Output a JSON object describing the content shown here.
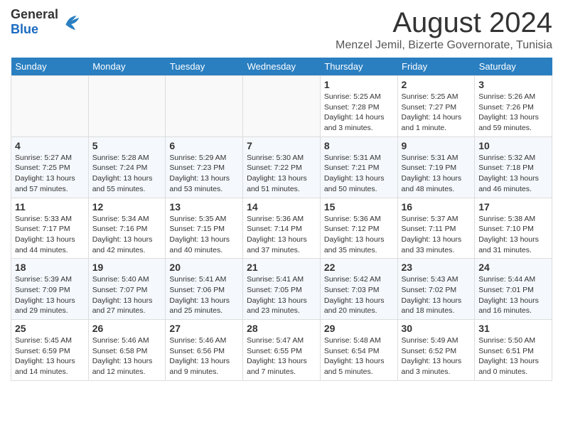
{
  "header": {
    "logo_general": "General",
    "logo_blue": "Blue",
    "month_title": "August 2024",
    "location": "Menzel Jemil, Bizerte Governorate, Tunisia"
  },
  "weekdays": [
    "Sunday",
    "Monday",
    "Tuesday",
    "Wednesday",
    "Thursday",
    "Friday",
    "Saturday"
  ],
  "weeks": [
    [
      {
        "day": "",
        "info": ""
      },
      {
        "day": "",
        "info": ""
      },
      {
        "day": "",
        "info": ""
      },
      {
        "day": "",
        "info": ""
      },
      {
        "day": "1",
        "info": "Sunrise: 5:25 AM\nSunset: 7:28 PM\nDaylight: 14 hours\nand 3 minutes."
      },
      {
        "day": "2",
        "info": "Sunrise: 5:25 AM\nSunset: 7:27 PM\nDaylight: 14 hours\nand 1 minute."
      },
      {
        "day": "3",
        "info": "Sunrise: 5:26 AM\nSunset: 7:26 PM\nDaylight: 13 hours\nand 59 minutes."
      }
    ],
    [
      {
        "day": "4",
        "info": "Sunrise: 5:27 AM\nSunset: 7:25 PM\nDaylight: 13 hours\nand 57 minutes."
      },
      {
        "day": "5",
        "info": "Sunrise: 5:28 AM\nSunset: 7:24 PM\nDaylight: 13 hours\nand 55 minutes."
      },
      {
        "day": "6",
        "info": "Sunrise: 5:29 AM\nSunset: 7:23 PM\nDaylight: 13 hours\nand 53 minutes."
      },
      {
        "day": "7",
        "info": "Sunrise: 5:30 AM\nSunset: 7:22 PM\nDaylight: 13 hours\nand 51 minutes."
      },
      {
        "day": "8",
        "info": "Sunrise: 5:31 AM\nSunset: 7:21 PM\nDaylight: 13 hours\nand 50 minutes."
      },
      {
        "day": "9",
        "info": "Sunrise: 5:31 AM\nSunset: 7:19 PM\nDaylight: 13 hours\nand 48 minutes."
      },
      {
        "day": "10",
        "info": "Sunrise: 5:32 AM\nSunset: 7:18 PM\nDaylight: 13 hours\nand 46 minutes."
      }
    ],
    [
      {
        "day": "11",
        "info": "Sunrise: 5:33 AM\nSunset: 7:17 PM\nDaylight: 13 hours\nand 44 minutes."
      },
      {
        "day": "12",
        "info": "Sunrise: 5:34 AM\nSunset: 7:16 PM\nDaylight: 13 hours\nand 42 minutes."
      },
      {
        "day": "13",
        "info": "Sunrise: 5:35 AM\nSunset: 7:15 PM\nDaylight: 13 hours\nand 40 minutes."
      },
      {
        "day": "14",
        "info": "Sunrise: 5:36 AM\nSunset: 7:14 PM\nDaylight: 13 hours\nand 37 minutes."
      },
      {
        "day": "15",
        "info": "Sunrise: 5:36 AM\nSunset: 7:12 PM\nDaylight: 13 hours\nand 35 minutes."
      },
      {
        "day": "16",
        "info": "Sunrise: 5:37 AM\nSunset: 7:11 PM\nDaylight: 13 hours\nand 33 minutes."
      },
      {
        "day": "17",
        "info": "Sunrise: 5:38 AM\nSunset: 7:10 PM\nDaylight: 13 hours\nand 31 minutes."
      }
    ],
    [
      {
        "day": "18",
        "info": "Sunrise: 5:39 AM\nSunset: 7:09 PM\nDaylight: 13 hours\nand 29 minutes."
      },
      {
        "day": "19",
        "info": "Sunrise: 5:40 AM\nSunset: 7:07 PM\nDaylight: 13 hours\nand 27 minutes."
      },
      {
        "day": "20",
        "info": "Sunrise: 5:41 AM\nSunset: 7:06 PM\nDaylight: 13 hours\nand 25 minutes."
      },
      {
        "day": "21",
        "info": "Sunrise: 5:41 AM\nSunset: 7:05 PM\nDaylight: 13 hours\nand 23 minutes."
      },
      {
        "day": "22",
        "info": "Sunrise: 5:42 AM\nSunset: 7:03 PM\nDaylight: 13 hours\nand 20 minutes."
      },
      {
        "day": "23",
        "info": "Sunrise: 5:43 AM\nSunset: 7:02 PM\nDaylight: 13 hours\nand 18 minutes."
      },
      {
        "day": "24",
        "info": "Sunrise: 5:44 AM\nSunset: 7:01 PM\nDaylight: 13 hours\nand 16 minutes."
      }
    ],
    [
      {
        "day": "25",
        "info": "Sunrise: 5:45 AM\nSunset: 6:59 PM\nDaylight: 13 hours\nand 14 minutes."
      },
      {
        "day": "26",
        "info": "Sunrise: 5:46 AM\nSunset: 6:58 PM\nDaylight: 13 hours\nand 12 minutes."
      },
      {
        "day": "27",
        "info": "Sunrise: 5:46 AM\nSunset: 6:56 PM\nDaylight: 13 hours\nand 9 minutes."
      },
      {
        "day": "28",
        "info": "Sunrise: 5:47 AM\nSunset: 6:55 PM\nDaylight: 13 hours\nand 7 minutes."
      },
      {
        "day": "29",
        "info": "Sunrise: 5:48 AM\nSunset: 6:54 PM\nDaylight: 13 hours\nand 5 minutes."
      },
      {
        "day": "30",
        "info": "Sunrise: 5:49 AM\nSunset: 6:52 PM\nDaylight: 13 hours\nand 3 minutes."
      },
      {
        "day": "31",
        "info": "Sunrise: 5:50 AM\nSunset: 6:51 PM\nDaylight: 13 hours\nand 0 minutes."
      }
    ]
  ]
}
